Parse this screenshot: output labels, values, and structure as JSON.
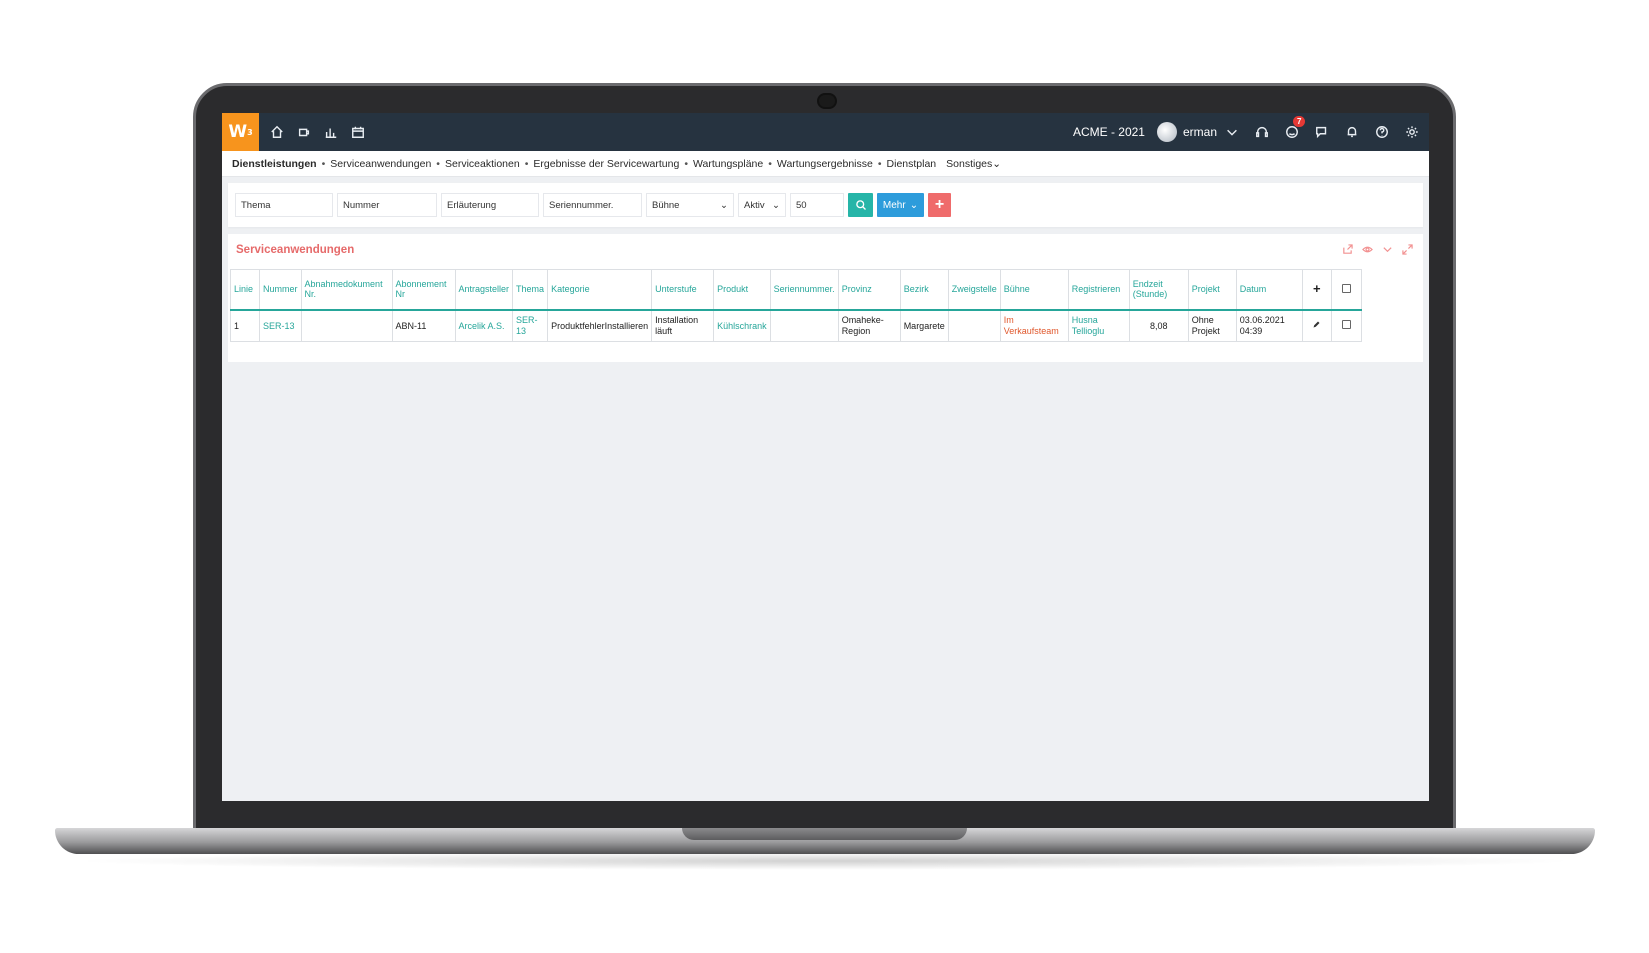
{
  "topbar": {
    "logo": "W",
    "logo_sup": "3",
    "company": "ACME - 2021",
    "username": "erman",
    "notification_count": "7"
  },
  "menu": {
    "items": [
      "Dienstleistungen",
      "Serviceanwendungen",
      "Serviceaktionen",
      "Ergebnisse der Servicewartung",
      "Wartungspläne",
      "Wartungsergebnisse",
      "Dienstplan"
    ],
    "more": "Sonstiges"
  },
  "filters": {
    "thema": "Thema",
    "nummer": "Nummer",
    "erlaeuterung": "Erläuterung",
    "seriennummer": "Seriennummer.",
    "buehne": "Bühne",
    "aktiv": "Aktiv",
    "limit": "50",
    "mehr": "Mehr",
    "add": "+"
  },
  "panel": {
    "title": "Serviceanwendungen"
  },
  "table": {
    "headers": [
      "Linie",
      "Nummer",
      "Abnahmedokument Nr.",
      "Abonnement Nr",
      "Antragsteller",
      "Thema",
      "Kategorie",
      "Unterstufe",
      "Produkt",
      "Seriennummer.",
      "Provinz",
      "Bezirk",
      "Zweigstelle",
      "Bühne",
      "Registrieren",
      "Endzeit (Stunde)",
      "Projekt",
      "Datum"
    ],
    "add_symbol": "+",
    "rows": [
      {
        "linie": "1",
        "nummer": "SER-13",
        "abnahmedokument": "",
        "abonnement": "ABN-11",
        "antragsteller": "Arcelik A.S.",
        "thema": "SER-13",
        "kategorie": "ProduktfehlerInstallieren",
        "unterstufe": "Installation läuft",
        "produkt": "Kühlschrank",
        "seriennummer": "",
        "provinz": "Omaheke-Region",
        "bezirk": "Margarete",
        "zweigstelle": "",
        "buehne": "Im Verkaufsteam",
        "registrieren": "Husna Tellioglu",
        "endzeit": "8,08",
        "projekt": "Ohne Projekt",
        "datum": "03.06.2021 04:39"
      }
    ]
  }
}
